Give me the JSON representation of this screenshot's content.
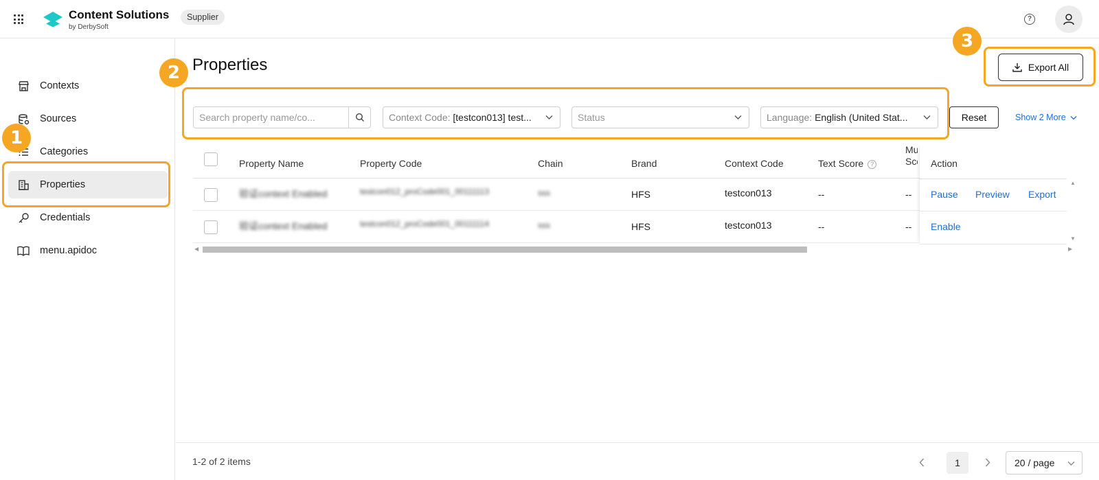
{
  "header": {
    "brand_title": "Content Solutions",
    "brand_sub": "by DerbySoft",
    "badge": "Supplier",
    "accent_color": "#1fc8c8"
  },
  "sidebar": {
    "items": [
      {
        "label": "Contexts",
        "icon": "store-icon"
      },
      {
        "label": "Sources",
        "icon": "database-settings-icon"
      },
      {
        "label": "Categories",
        "icon": "list-icon"
      },
      {
        "label": "Properties",
        "icon": "building-icon",
        "active": true
      },
      {
        "label": "Credentials",
        "icon": "key-icon"
      },
      {
        "label": "menu.apidoc",
        "icon": "book-icon"
      }
    ]
  },
  "main": {
    "title": "Properties",
    "export_label": "Export All",
    "filters": {
      "search_placeholder": "Search property name/co...",
      "context_prefix": "Context Code:",
      "context_value": "[testcon013] test...",
      "status_placeholder": "Status",
      "language_prefix": "Language:",
      "language_value": "English (United Stat...",
      "reset_label": "Reset",
      "show_more_label": "Show 2 More"
    },
    "table": {
      "columns": [
        "Property Name",
        "Property Code",
        "Chain",
        "Brand",
        "Context Code",
        "Text Score",
        "Mu Sco",
        "Action"
      ],
      "rows": [
        {
          "property_name": "验证context Enabled",
          "property_code": "testcon012_proCode001_00111113",
          "chain": "sss",
          "brand": "HFS",
          "context_code": "testcon013",
          "text_score": "--",
          "mu_score": "--",
          "actions": [
            "Pause",
            "Preview",
            "Export"
          ]
        },
        {
          "property_name": "验证context Enabled",
          "property_code": "testcon012_proCode001_00111114",
          "chain": "sss",
          "brand": "HFS",
          "context_code": "testcon013",
          "text_score": "--",
          "mu_score": "--",
          "actions": [
            "Enable"
          ]
        }
      ]
    }
  },
  "pagination": {
    "summary": "1-2 of 2 items",
    "current_page": "1",
    "page_size": "20 / page"
  },
  "callouts": [
    "1",
    "2",
    "3"
  ],
  "colors": {
    "highlight": "#f5a623",
    "link": "#1b6fd6"
  }
}
